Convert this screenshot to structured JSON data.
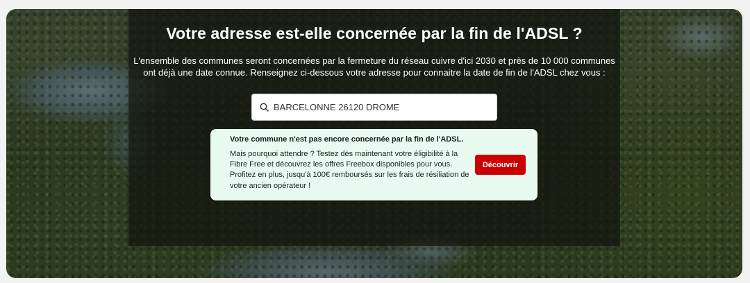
{
  "hero": {
    "title": "Votre adresse est-elle concernée par la fin de l'ADSL ?",
    "intro_line1": "L'ensemble des communes seront concernées par la fermeture du réseau cuivre d'ici 2030 et près de 10 000 communes",
    "intro_line2": "ont déjà une date connue. Renseignez ci-dessous votre adresse pour connaitre la date de fin de l'ADSL chez vous :"
  },
  "search": {
    "icon": "search-icon",
    "value": "BARCELONNE 26120 DROME"
  },
  "result": {
    "title": "Votre commune n'est pas encore concernée par la fin de l'ADSL.",
    "body_lines": [
      "Mais pourquoi attendre ? Testez dès maintenant votre éligibilité à la",
      "Fibre Free et découvrez les offres Freebox disponibles pour vous.",
      "Profitez en plus, jusqu'à 100€ remboursés sur les frais de résiliation de",
      "votre ancien opérateur !"
    ],
    "cta_label": "Découvrir"
  },
  "colors": {
    "cta": "#cc0000",
    "result_background": "#e9fbf1"
  }
}
